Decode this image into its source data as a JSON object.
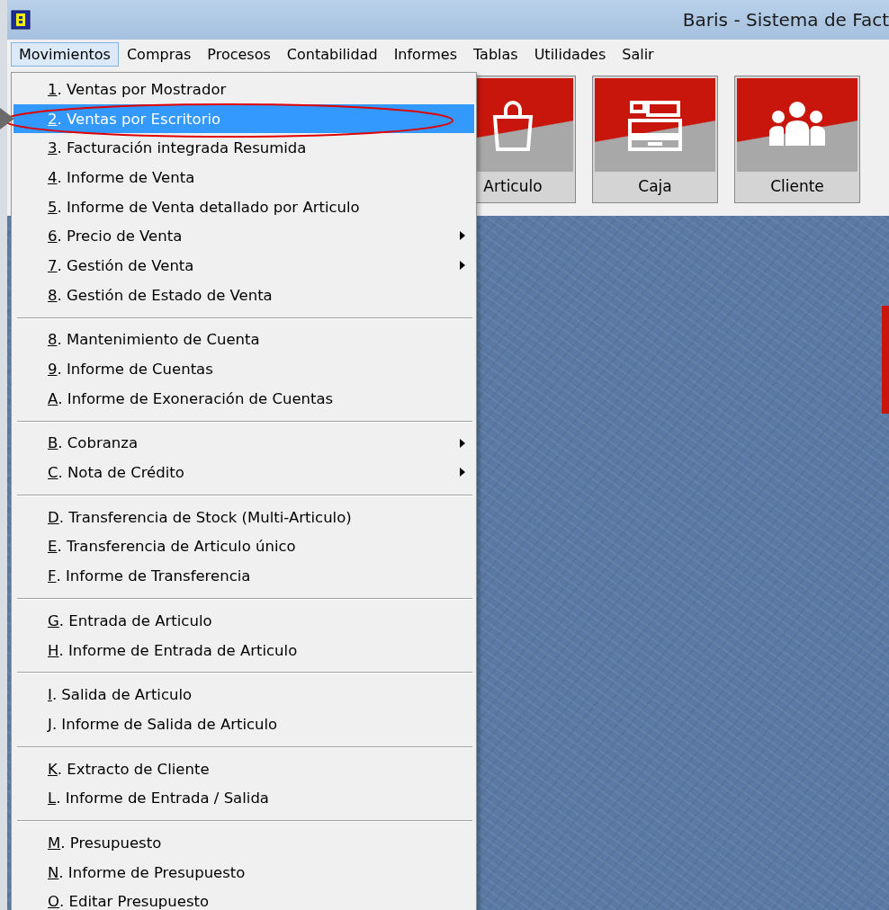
{
  "window": {
    "title": "Baris - Sistema de Fact"
  },
  "menu_bar": [
    {
      "label": "Movimientos",
      "selected": true
    },
    {
      "label": "Compras",
      "selected": false
    },
    {
      "label": "Procesos",
      "selected": false
    },
    {
      "label": "Contabilidad",
      "selected": false
    },
    {
      "label": "Informes",
      "selected": false
    },
    {
      "label": "Tablas",
      "selected": false
    },
    {
      "label": "Utilidades",
      "selected": false
    },
    {
      "label": "Salir",
      "selected": false
    }
  ],
  "toolbar": [
    {
      "label": "Articulo",
      "kind": "bag"
    },
    {
      "label": "Caja",
      "kind": "register"
    },
    {
      "label": "Cliente",
      "kind": "people"
    }
  ],
  "menu_groups": [
    [
      {
        "key": "1",
        "label": ". Ventas por Mostrador",
        "selected": false,
        "has_submenu": false
      },
      {
        "key": "2",
        "label": ". Ventas por Escritorio",
        "selected": true,
        "has_submenu": false
      },
      {
        "key": "3",
        "label": ". Facturación integrada Resumida",
        "selected": false,
        "has_submenu": false
      },
      {
        "key": "4",
        "label": ". Informe de Venta",
        "selected": false,
        "has_submenu": false
      },
      {
        "key": "5",
        "label": ". Informe de Venta detallado por Articulo",
        "selected": false,
        "has_submenu": false
      },
      {
        "key": "6",
        "label": ". Precio de Venta",
        "selected": false,
        "has_submenu": true
      },
      {
        "key": "7",
        "label": ". Gestión de Venta",
        "selected": false,
        "has_submenu": true
      },
      {
        "key": "8",
        "label": ". Gestión de Estado de Venta",
        "selected": false,
        "has_submenu": false
      }
    ],
    [
      {
        "key": "8",
        "label": ". Mantenimiento de Cuenta",
        "selected": false,
        "has_submenu": false
      },
      {
        "key": "9",
        "label": ". Informe de Cuentas",
        "selected": false,
        "has_submenu": false
      },
      {
        "key": "A",
        "label": ". Informe de Exoneración de Cuentas",
        "selected": false,
        "has_submenu": false
      }
    ],
    [
      {
        "key": "B",
        "label": ". Cobranza",
        "selected": false,
        "has_submenu": true
      },
      {
        "key": "C",
        "label": ". Nota de Crédito",
        "selected": false,
        "has_submenu": true
      }
    ],
    [
      {
        "key": "D",
        "label": ". Transferencia de Stock (Multi-Articulo)",
        "selected": false,
        "has_submenu": false
      },
      {
        "key": "E",
        "label": ". Transferencia de Articulo único",
        "selected": false,
        "has_submenu": false
      },
      {
        "key": "F",
        "label": ". Informe de Transferencia",
        "selected": false,
        "has_submenu": false
      }
    ],
    [
      {
        "key": "G",
        "label": ". Entrada de Articulo",
        "selected": false,
        "has_submenu": false
      },
      {
        "key": "H",
        "label": ". Informe de Entrada de Articulo",
        "selected": false,
        "has_submenu": false
      }
    ],
    [
      {
        "key": "I",
        "label": ". Salida de Articulo",
        "selected": false,
        "has_submenu": false
      },
      {
        "key": "J",
        "label": ". Informe de Salida de Articulo",
        "selected": false,
        "has_submenu": false
      }
    ],
    [
      {
        "key": "K",
        "label": ". Extracto de Cliente",
        "selected": false,
        "has_submenu": false
      },
      {
        "key": "L",
        "label": ". Informe de Entrada / Salida",
        "selected": false,
        "has_submenu": false
      }
    ],
    [
      {
        "key": "M",
        "label": ". Presupuesto",
        "selected": false,
        "has_submenu": false
      },
      {
        "key": "N",
        "label": ". Informe de Presupuesto",
        "selected": false,
        "has_submenu": false
      },
      {
        "key": "O",
        "label": ". Editar Presupuesto",
        "selected": false,
        "has_submenu": false
      }
    ]
  ]
}
